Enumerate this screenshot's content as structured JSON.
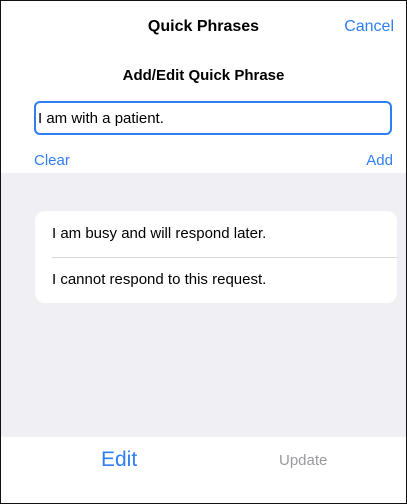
{
  "header": {
    "title": "Quick Phrases",
    "cancel_label": "Cancel"
  },
  "editor": {
    "section_title": "Add/Edit Quick Phrase",
    "input_value": "I am with a patient.",
    "clear_label": "Clear",
    "add_label": "Add"
  },
  "phrases": [
    "I am busy and will respond later.",
    "I cannot respond to this request."
  ],
  "toolbar": {
    "edit_label": "Edit",
    "update_label": "Update",
    "update_enabled": false
  },
  "colors": {
    "accent": "#2f7ff0",
    "disabled": "#9a9a9e",
    "content_background": "#f0f0f4"
  }
}
